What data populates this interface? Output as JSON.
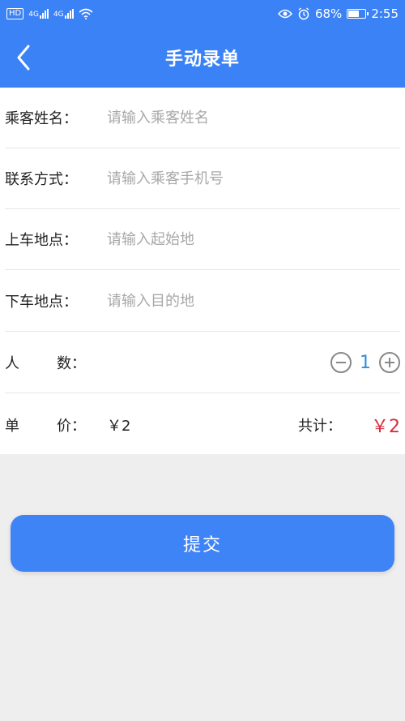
{
  "status_bar": {
    "hd": "HD",
    "net1": "4G",
    "net2": "4G",
    "battery_pct": "68%",
    "battery_level": 0.68,
    "time": "2:55",
    "icons": [
      "hd-icon",
      "signal-icon",
      "wifi-icon",
      "eye-icon",
      "alarm-icon",
      "battery-icon"
    ]
  },
  "nav": {
    "back_icon": "chevron-left-icon",
    "title": "手动录单"
  },
  "form": {
    "passenger_name": {
      "label": "乘客姓名：",
      "placeholder": "请输入乘客姓名",
      "value": ""
    },
    "contact": {
      "label": "联系方式：",
      "placeholder": "请输入乘客手机号",
      "value": ""
    },
    "pickup": {
      "label": "上车地点：",
      "placeholder": "请输入起始地",
      "value": ""
    },
    "dropoff": {
      "label": "下车地点：",
      "placeholder": "请输入目的地",
      "value": ""
    },
    "people": {
      "label_a": "人",
      "label_b": "数：",
      "count": "1"
    },
    "price": {
      "label_a": "单",
      "label_b": "价：",
      "value": "￥2",
      "total_label": "共计：",
      "total_value": "￥2"
    }
  },
  "submit_label": "提交",
  "colors": {
    "primary": "#3b82f6",
    "price_red": "#d92d3f",
    "count_blue": "#2f8fd8"
  }
}
